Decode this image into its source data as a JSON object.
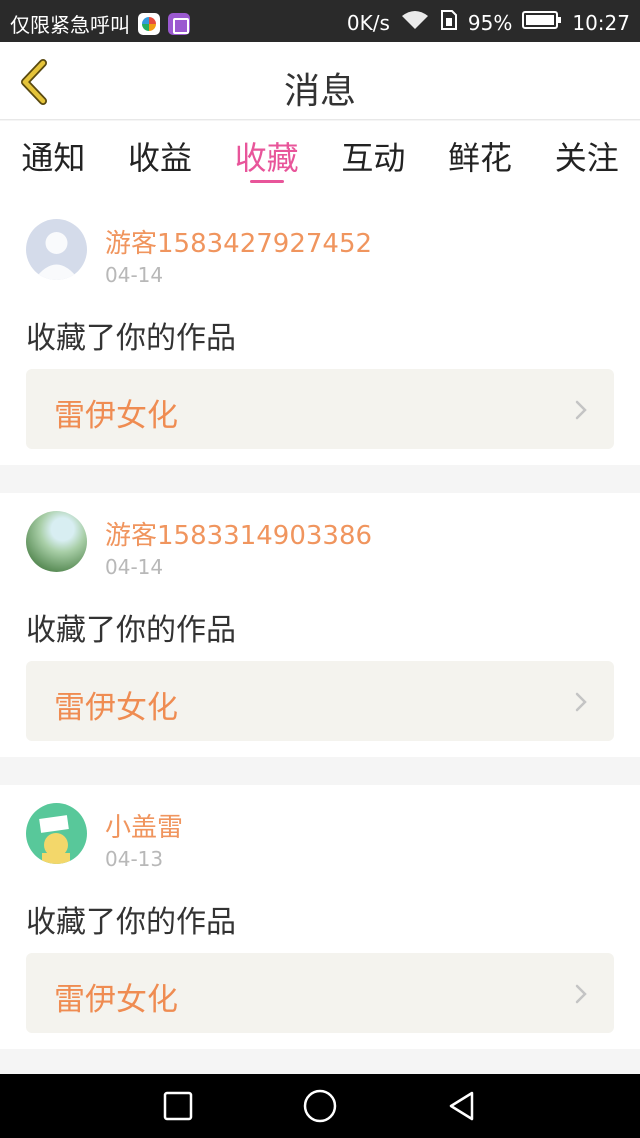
{
  "status_bar": {
    "carrier_text": "仅限紧急呼叫",
    "net_speed": "0K/s",
    "battery": "95%",
    "time": "10:27"
  },
  "header": {
    "title": "消息"
  },
  "tabs": [
    {
      "label": "通知",
      "active": false
    },
    {
      "label": "收益",
      "active": false
    },
    {
      "label": "收藏",
      "active": true
    },
    {
      "label": "互动",
      "active": false
    },
    {
      "label": "鲜花",
      "active": false
    },
    {
      "label": "关注",
      "active": false
    }
  ],
  "messages": [
    {
      "username": "游客1583427927452",
      "date": "04-14",
      "action": "收藏了你的作品",
      "work_title": "雷伊女化"
    },
    {
      "username": "游客1583314903386",
      "date": "04-14",
      "action": "收藏了你的作品",
      "work_title": "雷伊女化"
    },
    {
      "username": "小盖雷",
      "date": "04-13",
      "action": "收藏了你的作品",
      "work_title": "雷伊女化"
    }
  ],
  "colors": {
    "accent_pink": "#e8559a",
    "username_orange": "#f0955e",
    "work_title_orange": "#ef8c52",
    "work_box_bg": "#f4f3ee",
    "back_arrow": "#d6b42e"
  },
  "icons": [
    "back-arrow-icon",
    "chevron-right-icon",
    "wifi-icon",
    "sim-icon",
    "battery-icon",
    "nav-recent-icon",
    "nav-home-icon",
    "nav-back-icon"
  ]
}
